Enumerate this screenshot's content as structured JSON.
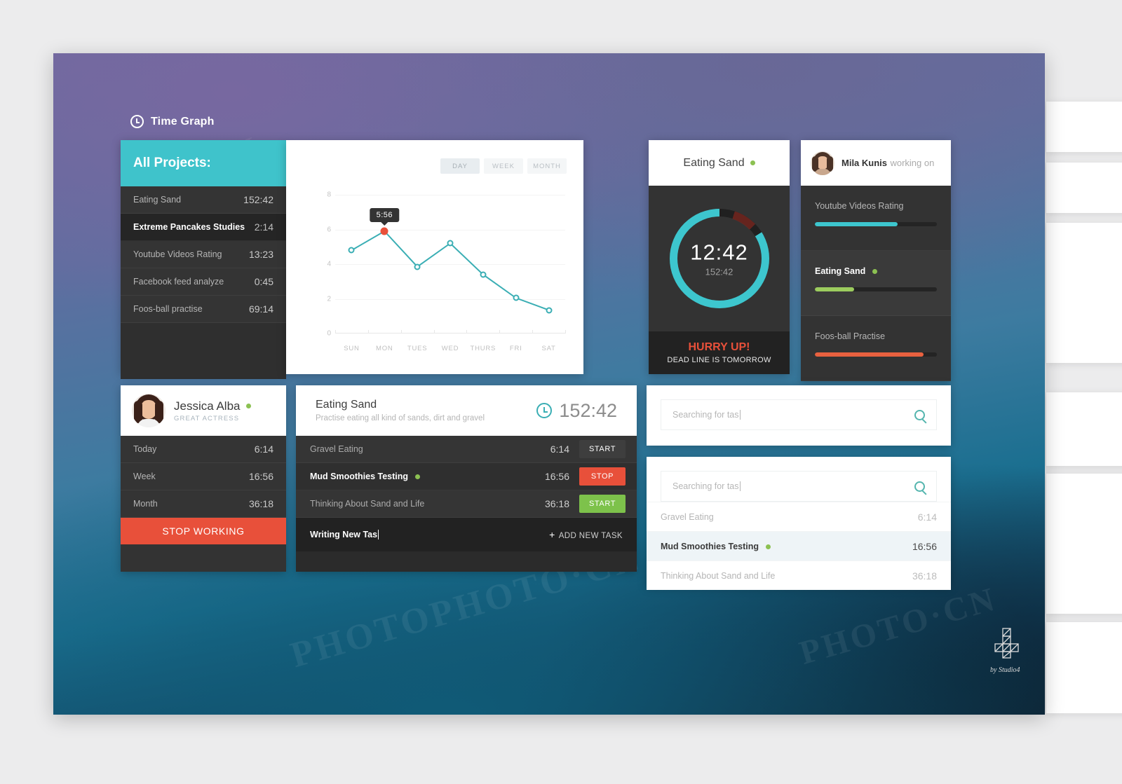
{
  "header": {
    "title": "Time Graph",
    "icon": "clock-icon"
  },
  "colors": {
    "teal": "#3fc3cb",
    "ring_teal": "#3dc6ce",
    "orange": "#e8503a",
    "green": "#8cc152",
    "dark": "#333333",
    "panel_dark": "#2f2f2f",
    "line_teal": "#3aaeb4",
    "selected_row": "#eef4f7"
  },
  "projects": {
    "title": "All Projects:",
    "rows": [
      {
        "name": "Eating Sand",
        "time": "152:42",
        "selected": false
      },
      {
        "name": "Extreme Pancakes Studies",
        "time": "2:14",
        "selected": true
      },
      {
        "name": "Youtube Videos Rating",
        "time": "13:23",
        "selected": false
      },
      {
        "name": "Facebook feed analyze",
        "time": "0:45",
        "selected": false
      },
      {
        "name": "Foos-ball practise",
        "time": "69:14",
        "selected": false
      }
    ]
  },
  "chart_panel": {
    "range_buttons": [
      {
        "label": "DAY",
        "active": true
      },
      {
        "label": "WEEK",
        "active": false
      },
      {
        "label": "MONTH",
        "active": false
      }
    ],
    "tooltip": "5:56"
  },
  "chart_data": {
    "type": "line",
    "title": "",
    "xlabel": "",
    "ylabel": "",
    "categories": [
      "SUN",
      "MON",
      "TUES",
      "WED",
      "THURS",
      "FRI",
      "SAT"
    ],
    "values": [
      4.8,
      5.9,
      3.85,
      5.2,
      3.4,
      2.05,
      1.35
    ],
    "yticks": [
      0,
      2,
      4,
      6,
      8
    ],
    "ylim": [
      0,
      8
    ],
    "grid": true,
    "legend": "none",
    "highlight_index": 1,
    "highlight_label": "5:56",
    "series_color": "#3aaeb4",
    "highlight_color": "#e8503a"
  },
  "timer": {
    "project": "Eating Sand",
    "status_dot": "active",
    "current": "12:42",
    "total": "152:42",
    "progress_percent": 84,
    "alert_title": "HURRY UP!",
    "alert_sub": "DEAD LINE IS TOMORROW"
  },
  "working_on": {
    "user": "Mila Kunis",
    "suffix": "working on",
    "avatar": "avatar-mila",
    "items": [
      {
        "name": "Youtube Videos Rating",
        "percent": 68,
        "color": "#3dc6ce",
        "selected": false
      },
      {
        "name": "Eating Sand",
        "percent": 32,
        "color": "#9ccc5e",
        "selected": true
      },
      {
        "name": "Foos-ball Practise",
        "percent": 89,
        "color": "#e8613f",
        "selected": false
      }
    ]
  },
  "profile": {
    "name": "Jessica Alba",
    "role": "GREAT ACTRESS",
    "avatar": "avatar-jessica",
    "status_dot": "active",
    "stats": [
      {
        "label": "Today",
        "value": "6:14"
      },
      {
        "label": "Week",
        "value": "16:56"
      },
      {
        "label": "Month",
        "value": "36:18"
      }
    ],
    "stop_button": "STOP WORKING"
  },
  "task_panel": {
    "title": "Eating Sand",
    "subtitle": "Practise eating all kind of sands, dirt and gravel",
    "total_time": "152:42",
    "rows": [
      {
        "name": "Gravel Eating",
        "time": "6:14",
        "button": "START",
        "button_color": "#3e3e3e",
        "selected": false
      },
      {
        "name": "Mud Smoothies Testing",
        "time": "16:56",
        "button": "STOP",
        "button_color": "#e8503a",
        "selected": true,
        "dot": true
      },
      {
        "name": "Thinking About Sand and Life",
        "time": "36:18",
        "button": "START",
        "button_color": "#7dc24b",
        "selected": false
      }
    ],
    "new_task_value": "Writing New Tas",
    "add_task_label": "ADD NEW TASK"
  },
  "search_simple": {
    "placeholder": "Searching for tas",
    "value": "Searching for tas",
    "icon": "search-icon"
  },
  "search_results": {
    "placeholder": "Searching for tas",
    "value": "Searching for tas",
    "icon": "search-icon",
    "rows": [
      {
        "name": "Gravel Eating",
        "time": "6:14",
        "selected": false
      },
      {
        "name": "Mud Smoothies Testing",
        "time": "16:56",
        "selected": true,
        "dot": true
      },
      {
        "name": "Thinking About Sand and Life",
        "time": "36:18",
        "selected": false
      }
    ]
  },
  "footer": {
    "credit": "by Studio4"
  }
}
